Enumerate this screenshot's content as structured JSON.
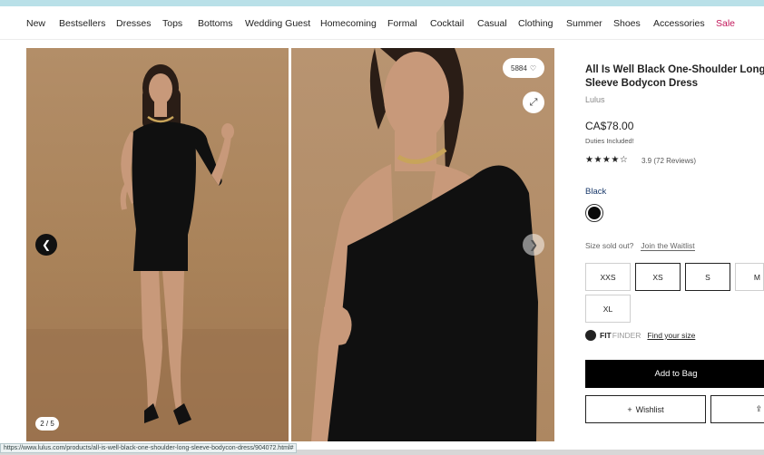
{
  "nav": {
    "items": [
      "New",
      "Bestsellers",
      "Dresses",
      "Tops",
      "Bottoms",
      "Wedding Guest",
      "Homecoming",
      "Formal",
      "Cocktail",
      "Casual",
      "Clothing",
      "Summer",
      "Shoes",
      "Accessories",
      "Sale"
    ]
  },
  "gallery": {
    "counter": "2 / 5",
    "favorites_count": "5884",
    "icons": {
      "prev": "chevron-left-icon",
      "next": "chevron-right-icon",
      "favorite": "heart-icon",
      "expand": "expand-icon"
    }
  },
  "product": {
    "title": "All Is Well Black One-Shoulder Long Sleeve Bodycon Dress",
    "brand": "Lulus",
    "price": "CA$78.00",
    "duties": "Duties Included!",
    "stars": "★★★★☆",
    "rating_text": "3.9 (72 Reviews)",
    "rating_value": 3.9,
    "color_label": "Black",
    "color_hex": "#0a0a0a",
    "soldout_text": "Size sold out?",
    "waitlist_link": "Join the Waitlist",
    "sizes": [
      "XXS",
      "XS",
      "S",
      "M",
      "XL"
    ],
    "fit_brand": "FIT",
    "fit_suffix": "FINDER",
    "fit_link": "Find your size",
    "add_to_bag": "Add to Bag",
    "wishlist": "Wishlist",
    "wishlist_plus": "+",
    "share_icon": "⇪"
  },
  "status_url": "https://www.lulus.com/products/all-is-well-black-one-shoulder-long-sleeve-bodycon-dress/904072.html#"
}
